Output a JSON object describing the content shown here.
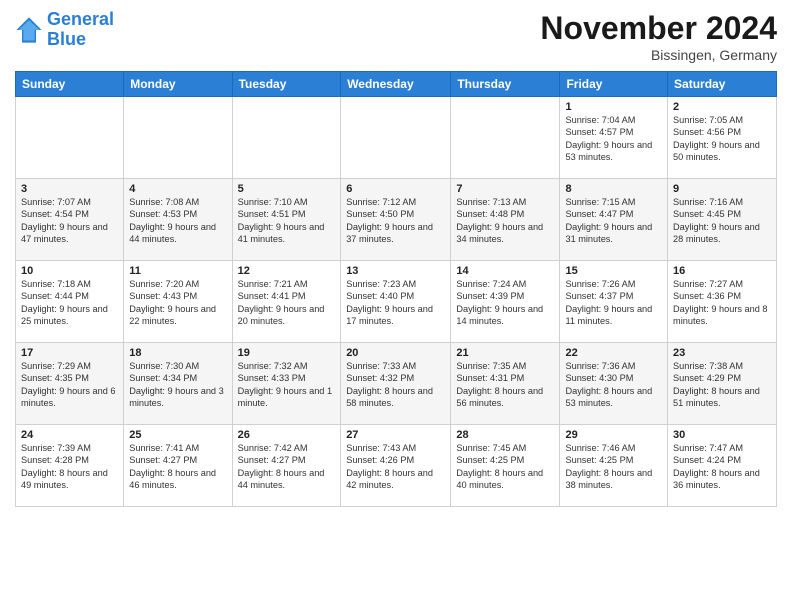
{
  "header": {
    "logo_line1": "General",
    "logo_line2": "Blue",
    "month_title": "November 2024",
    "location": "Bissingen, Germany"
  },
  "weekdays": [
    "Sunday",
    "Monday",
    "Tuesday",
    "Wednesday",
    "Thursday",
    "Friday",
    "Saturday"
  ],
  "weeks": [
    [
      {
        "day": "",
        "info": ""
      },
      {
        "day": "",
        "info": ""
      },
      {
        "day": "",
        "info": ""
      },
      {
        "day": "",
        "info": ""
      },
      {
        "day": "",
        "info": ""
      },
      {
        "day": "1",
        "info": "Sunrise: 7:04 AM\nSunset: 4:57 PM\nDaylight: 9 hours and 53 minutes."
      },
      {
        "day": "2",
        "info": "Sunrise: 7:05 AM\nSunset: 4:56 PM\nDaylight: 9 hours and 50 minutes."
      }
    ],
    [
      {
        "day": "3",
        "info": "Sunrise: 7:07 AM\nSunset: 4:54 PM\nDaylight: 9 hours and 47 minutes."
      },
      {
        "day": "4",
        "info": "Sunrise: 7:08 AM\nSunset: 4:53 PM\nDaylight: 9 hours and 44 minutes."
      },
      {
        "day": "5",
        "info": "Sunrise: 7:10 AM\nSunset: 4:51 PM\nDaylight: 9 hours and 41 minutes."
      },
      {
        "day": "6",
        "info": "Sunrise: 7:12 AM\nSunset: 4:50 PM\nDaylight: 9 hours and 37 minutes."
      },
      {
        "day": "7",
        "info": "Sunrise: 7:13 AM\nSunset: 4:48 PM\nDaylight: 9 hours and 34 minutes."
      },
      {
        "day": "8",
        "info": "Sunrise: 7:15 AM\nSunset: 4:47 PM\nDaylight: 9 hours and 31 minutes."
      },
      {
        "day": "9",
        "info": "Sunrise: 7:16 AM\nSunset: 4:45 PM\nDaylight: 9 hours and 28 minutes."
      }
    ],
    [
      {
        "day": "10",
        "info": "Sunrise: 7:18 AM\nSunset: 4:44 PM\nDaylight: 9 hours and 25 minutes."
      },
      {
        "day": "11",
        "info": "Sunrise: 7:20 AM\nSunset: 4:43 PM\nDaylight: 9 hours and 22 minutes."
      },
      {
        "day": "12",
        "info": "Sunrise: 7:21 AM\nSunset: 4:41 PM\nDaylight: 9 hours and 20 minutes."
      },
      {
        "day": "13",
        "info": "Sunrise: 7:23 AM\nSunset: 4:40 PM\nDaylight: 9 hours and 17 minutes."
      },
      {
        "day": "14",
        "info": "Sunrise: 7:24 AM\nSunset: 4:39 PM\nDaylight: 9 hours and 14 minutes."
      },
      {
        "day": "15",
        "info": "Sunrise: 7:26 AM\nSunset: 4:37 PM\nDaylight: 9 hours and 11 minutes."
      },
      {
        "day": "16",
        "info": "Sunrise: 7:27 AM\nSunset: 4:36 PM\nDaylight: 9 hours and 8 minutes."
      }
    ],
    [
      {
        "day": "17",
        "info": "Sunrise: 7:29 AM\nSunset: 4:35 PM\nDaylight: 9 hours and 6 minutes."
      },
      {
        "day": "18",
        "info": "Sunrise: 7:30 AM\nSunset: 4:34 PM\nDaylight: 9 hours and 3 minutes."
      },
      {
        "day": "19",
        "info": "Sunrise: 7:32 AM\nSunset: 4:33 PM\nDaylight: 9 hours and 1 minute."
      },
      {
        "day": "20",
        "info": "Sunrise: 7:33 AM\nSunset: 4:32 PM\nDaylight: 8 hours and 58 minutes."
      },
      {
        "day": "21",
        "info": "Sunrise: 7:35 AM\nSunset: 4:31 PM\nDaylight: 8 hours and 56 minutes."
      },
      {
        "day": "22",
        "info": "Sunrise: 7:36 AM\nSunset: 4:30 PM\nDaylight: 8 hours and 53 minutes."
      },
      {
        "day": "23",
        "info": "Sunrise: 7:38 AM\nSunset: 4:29 PM\nDaylight: 8 hours and 51 minutes."
      }
    ],
    [
      {
        "day": "24",
        "info": "Sunrise: 7:39 AM\nSunset: 4:28 PM\nDaylight: 8 hours and 49 minutes."
      },
      {
        "day": "25",
        "info": "Sunrise: 7:41 AM\nSunset: 4:27 PM\nDaylight: 8 hours and 46 minutes."
      },
      {
        "day": "26",
        "info": "Sunrise: 7:42 AM\nSunset: 4:27 PM\nDaylight: 8 hours and 44 minutes."
      },
      {
        "day": "27",
        "info": "Sunrise: 7:43 AM\nSunset: 4:26 PM\nDaylight: 8 hours and 42 minutes."
      },
      {
        "day": "28",
        "info": "Sunrise: 7:45 AM\nSunset: 4:25 PM\nDaylight: 8 hours and 40 minutes."
      },
      {
        "day": "29",
        "info": "Sunrise: 7:46 AM\nSunset: 4:25 PM\nDaylight: 8 hours and 38 minutes."
      },
      {
        "day": "30",
        "info": "Sunrise: 7:47 AM\nSunset: 4:24 PM\nDaylight: 8 hours and 36 minutes."
      }
    ]
  ]
}
